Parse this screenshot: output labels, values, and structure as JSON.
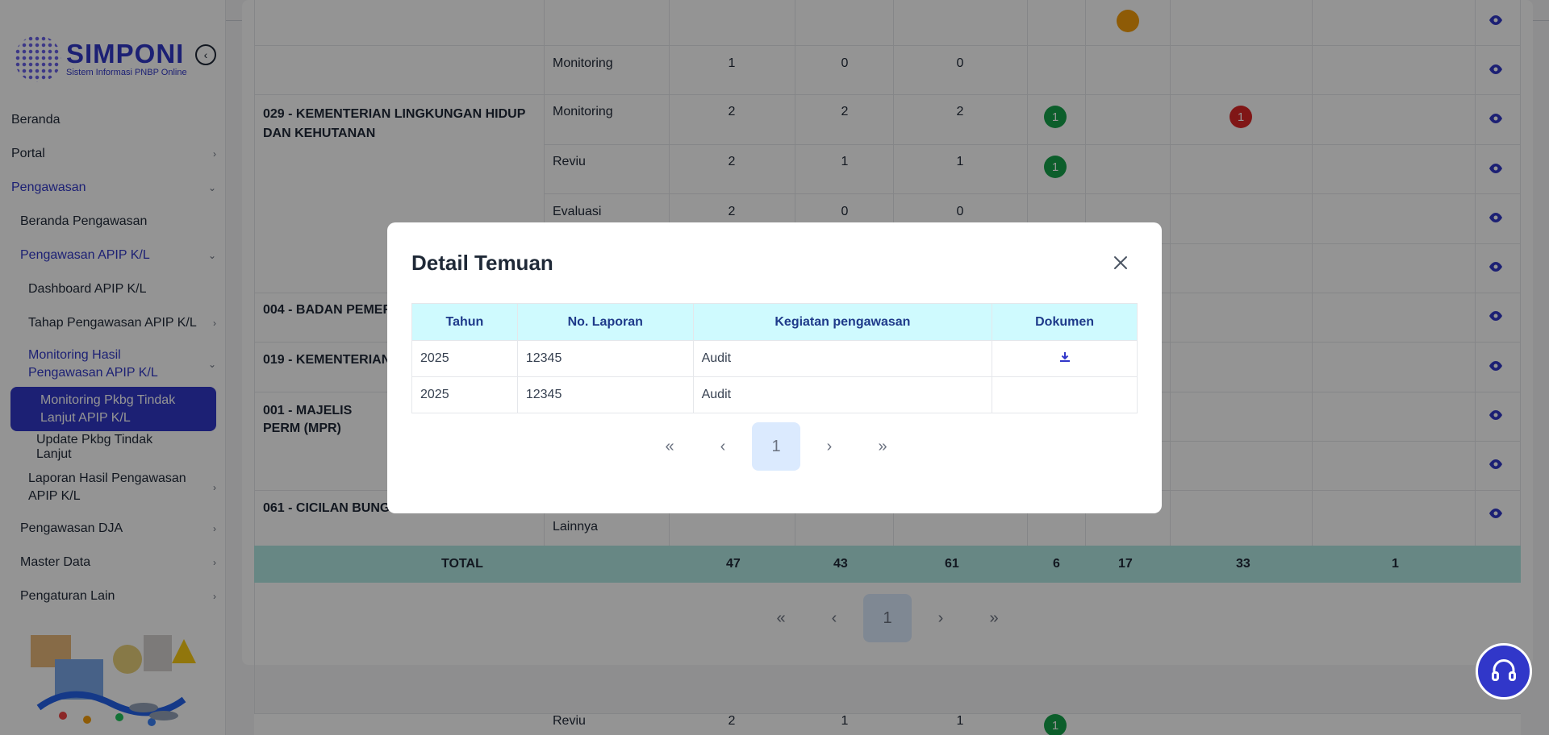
{
  "sidebar": {
    "logo_title": "SIMPONI",
    "logo_subtitle": "Sistem Informasi PNBP Online",
    "items": [
      {
        "label": "Beranda"
      },
      {
        "label": "Portal"
      },
      {
        "label": "Pengawasan"
      },
      {
        "label": "Beranda Pengawasan"
      },
      {
        "label": "Pengawasan APIP K/L"
      },
      {
        "label": "Dashboard APIP K/L"
      },
      {
        "label": "Tahap Pengawasan APIP K/L"
      },
      {
        "label": "Monitoring Hasil Pengawasan APIP K/L"
      },
      {
        "label": "Monitoring Pkbg Tindak Lanjut APIP K/L"
      },
      {
        "label": "Update Pkbg Tindak Lanjut"
      },
      {
        "label": "Laporan Hasil Pengawasan APIP K/L"
      },
      {
        "label": "Pengawasan DJA"
      },
      {
        "label": "Master Data"
      },
      {
        "label": "Pengaturan Lain"
      }
    ]
  },
  "table": {
    "rows": [
      {
        "kl": "",
        "kegiatan": "Monitoring",
        "c1": "1",
        "c2": "0",
        "c3": "0"
      },
      {
        "kl": "029 - KEMENTERIAN LINGKUNGAN HIDUP DAN KEHUTANAN",
        "kegiatan": "Monitoring",
        "c1": "2",
        "c2": "2",
        "c3": "2",
        "b_green": "1",
        "b_red": "1"
      },
      {
        "kl": "",
        "kegiatan": "Reviu",
        "c1": "2",
        "c2": "1",
        "c3": "1",
        "b_green": "1"
      },
      {
        "kl": "",
        "kegiatan": "Evaluasi",
        "c1": "2",
        "c2": "0",
        "c3": "0"
      },
      {
        "kl": "004 - BADAN PEMER"
      },
      {
        "kl": "019 - KEMENTERIAN"
      },
      {
        "kl": "001 - MAJELIS PERM (MPR)"
      },
      {
        "kl": "061 - CICILAN BUNGA",
        "kegiatan": "Lainnya"
      }
    ],
    "total": {
      "label": "TOTAL",
      "c1": "47",
      "c2": "43",
      "c3": "61",
      "c4": "6",
      "c5": "17",
      "c6": "33",
      "c7": "1"
    },
    "bottom_row": {
      "kegiatan": "Reviu",
      "c1": "2",
      "c2": "1",
      "c3": "1",
      "b_green": "1"
    },
    "pager": {
      "first": "«",
      "prev": "‹",
      "current": "1",
      "next": "›",
      "last": "»"
    }
  },
  "modal": {
    "title": "Detail Temuan",
    "columns": [
      "Tahun",
      "No. Laporan",
      "Kegiatan pengawasan",
      "Dokumen"
    ],
    "rows": [
      {
        "tahun": "2025",
        "no": "12345",
        "kegiatan": "Audit",
        "has_doc": true
      },
      {
        "tahun": "2025",
        "no": "12345",
        "kegiatan": "Audit",
        "has_doc": false
      }
    ],
    "pager": {
      "first": "«",
      "prev": "‹",
      "current": "1",
      "next": "›",
      "last": "»"
    }
  },
  "colors": {
    "brand": "#3137c9",
    "teal_total": "#b2e8e4",
    "modal_header": "#cffafe"
  }
}
